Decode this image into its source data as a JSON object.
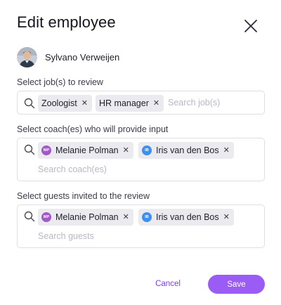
{
  "dialog": {
    "title": "Edit employee"
  },
  "employee": {
    "name": "Sylvano Verweijen"
  },
  "jobs": {
    "label": "Select job(s) to review",
    "placeholder": "Search job(s)",
    "chips": [
      {
        "label": "Zoologist"
      },
      {
        "label": "HR manager"
      }
    ]
  },
  "coaches": {
    "label": "Select coach(es) who will provide input",
    "placeholder": "Search coach(es)",
    "chips": [
      {
        "label": "Melanie Polman",
        "initials": "MP",
        "color": "#a259c8"
      },
      {
        "label": "Iris van den Bos",
        "initials": "IB",
        "color": "#3d8ff0"
      }
    ]
  },
  "guests": {
    "label": "Select guests invited to the review",
    "placeholder": "Search guests",
    "chips": [
      {
        "label": "Melanie Polman",
        "initials": "MP",
        "color": "#a259c8"
      },
      {
        "label": "Iris van den Bos",
        "initials": "IB",
        "color": "#3d8ff0"
      }
    ]
  },
  "actions": {
    "cancel_label": "Cancel",
    "save_label": "Save"
  },
  "colors": {
    "accent": "#9a5cf4",
    "accent_text": "#7b3fe4"
  }
}
